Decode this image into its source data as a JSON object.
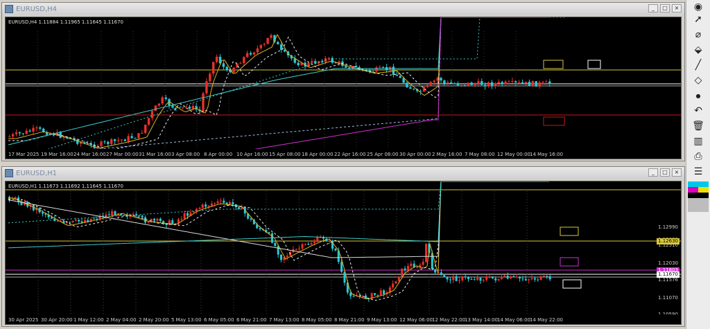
{
  "top_window": {
    "title": "EURUSD,H4",
    "ohlc": "EURUSD,H4 1.11884 1.11965 1.11645 1.11670",
    "x_labels": [
      "17 Mar 2025",
      "19 Mar 16:00",
      "24 Mar 16:00",
      "27 Mar 00:00",
      "31 Mar 16:00",
      "3 Apr 08:00",
      "8 Apr 00:00",
      "10 Apr 16:00",
      "15 Apr 08:00",
      "18 Apr 00:00",
      "22 Apr 16:00",
      "25 Apr 08:00",
      "30 Apr 00:00",
      "2 May 16:00",
      "7 May 08:00",
      "12 May 00:00",
      "14 May 16:00"
    ]
  },
  "bottom_window": {
    "title": "EURUSD,H1",
    "ohlc": "EURUSD,H1 1.11673 1.11692 1.11645 1.11670",
    "x_labels": [
      "30 Apr 2025",
      "30 Apr 20:00",
      "1 May 12:00",
      "2 May 04:00",
      "2 May 20:00",
      "5 May 13:00",
      "6 May 05:00",
      "6 May 21:00",
      "7 May 13:00",
      "8 May 05:00",
      "8 May 21:00",
      "9 May 13:00",
      "12 May 06:00",
      "12 May 22:00",
      "13 May 14:00",
      "14 May 06:00",
      "14 May 22:00"
    ],
    "price_labels": [
      "1.12990",
      "1.12630",
      "1.12510",
      "1.12030",
      "1.11803",
      "1.11670",
      "1.11576",
      "1.11070",
      "1.10590"
    ],
    "price_tags": {
      "yellow": "1.12630",
      "magenta": "1.11803",
      "white": "1.11670"
    }
  },
  "colors": {
    "yellow": "#d8c83a",
    "cyan": "#3fd0d0",
    "red_line": "#c81818",
    "magenta": "#d030d0",
    "bull": "#e8302a",
    "bear": "#28c8d8"
  },
  "toolbar_icons": [
    "eye-icon",
    "cursor-icon",
    "target-icon",
    "eraser-icon",
    "line-icon",
    "rect-icon",
    "dot-icon",
    "undo-icon",
    "trash-icon",
    "bars-icon",
    "printer-icon",
    "camera-icon",
    "list-icon"
  ]
}
